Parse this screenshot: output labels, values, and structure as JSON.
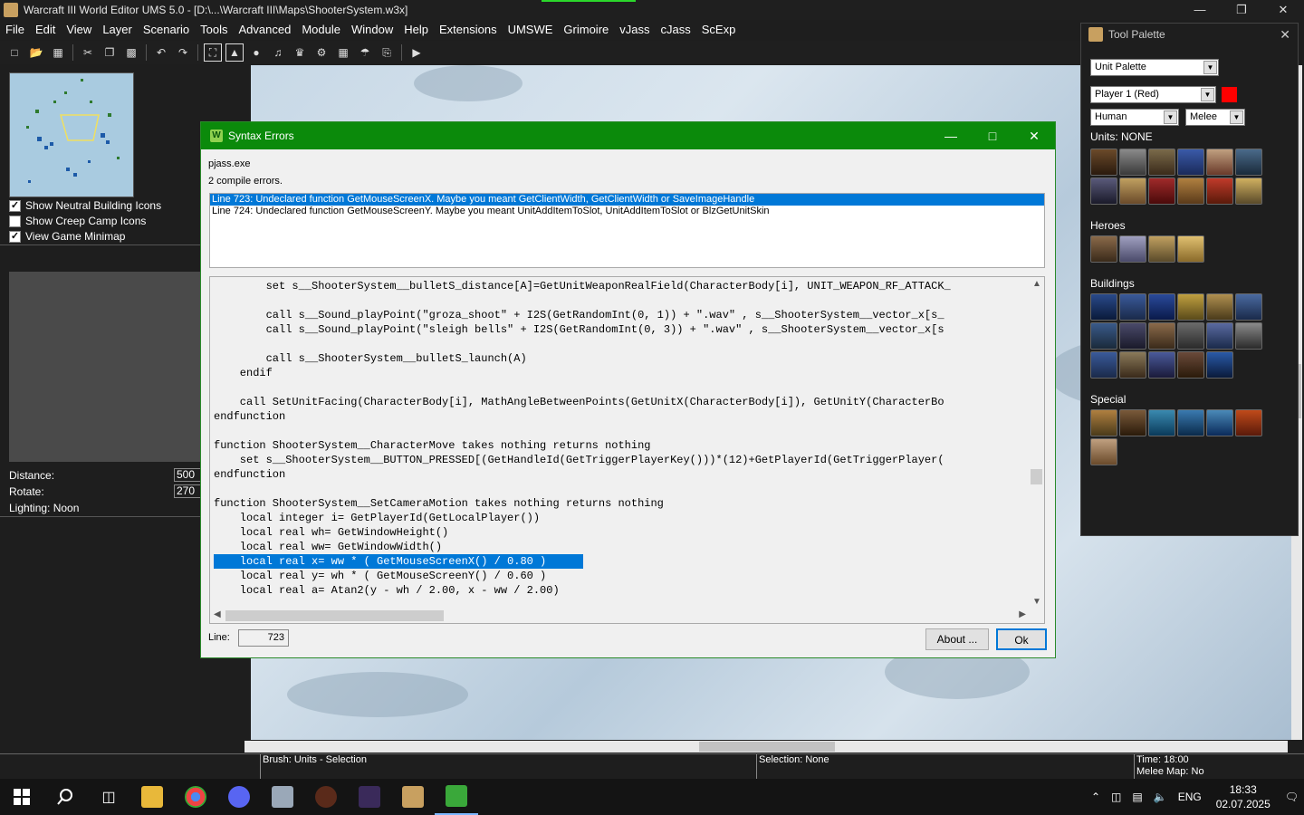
{
  "window": {
    "title": "Warcraft III World Editor UMS 5.0 - [D:\\...\\Warcraft III\\Maps\\ShooterSystem.w3x]"
  },
  "menu": [
    "File",
    "Edit",
    "View",
    "Layer",
    "Scenario",
    "Tools",
    "Advanced",
    "Module",
    "Window",
    "Help",
    "Extensions",
    "UMSWE",
    "Grimoire",
    "vJass",
    "cJass",
    "ScExp"
  ],
  "left_panel": {
    "checkboxes": [
      {
        "label": "Show Neutral Building Icons",
        "checked": true
      },
      {
        "label": "Show Creep Camp Icons",
        "checked": false
      },
      {
        "label": "View Game Minimap",
        "checked": true
      }
    ],
    "distance_label": "Distance:",
    "distance_value": "500",
    "rotate_label": "Rotate:",
    "rotate_value": "270",
    "lighting": "Lighting: Noon"
  },
  "status": {
    "brush": "Brush: Units - Selection",
    "selection": "Selection: None",
    "time": "Time: 18:00",
    "melee": "Melee Map: No"
  },
  "palette": {
    "title": "Tool Palette",
    "palette_select": "Unit Palette",
    "player_select": "Player 1 (Red)",
    "player_color": "#ff0000",
    "race_select": "Human",
    "mode_select": "Melee",
    "units_label": "Units: NONE",
    "heroes_label": "Heroes",
    "buildings_label": "Buildings",
    "special_label": "Special"
  },
  "dialog": {
    "title": "Syntax Errors",
    "exe": "pjass.exe",
    "summary": "2 compile errors.",
    "errors": [
      "Line 723:  Undeclared function GetMouseScreenX. Maybe you meant GetClientWidth, GetClientWidth or SaveImageHandle",
      "Line 724:  Undeclared function GetMouseScreenY. Maybe you meant UnitAddItemToSlot, UnitAddItemToSlot or BlzGetUnitSkin"
    ],
    "code": [
      "        set s__ShooterSystem__bulletS_distance[A]=GetUnitWeaponRealField(CharacterBody[i], UNIT_WEAPON_RF_ATTACK_",
      "",
      "        call s__Sound_playPoint(\"groza_shoot\" + I2S(GetRandomInt(0, 1)) + \".wav\" , s__ShooterSystem__vector_x[s_",
      "        call s__Sound_playPoint(\"sleigh bells\" + I2S(GetRandomInt(0, 3)) + \".wav\" , s__ShooterSystem__vector_x[s",
      "",
      "        call s__ShooterSystem__bulletS_launch(A)",
      "    endif",
      "",
      "    call SetUnitFacing(CharacterBody[i], MathAngleBetweenPoints(GetUnitX(CharacterBody[i]), GetUnitY(CharacterBo",
      "endfunction",
      "",
      "function ShooterSystem__CharacterMove takes nothing returns nothing",
      "    set s__ShooterSystem__BUTTON_PRESSED[(GetHandleId(GetTriggerPlayerKey()))*(12)+GetPlayerId(GetTriggerPlayer(",
      "endfunction",
      "",
      "function ShooterSystem__SetCameraMotion takes nothing returns nothing",
      "    local integer i= GetPlayerId(GetLocalPlayer())",
      "    local real wh= GetWindowHeight()",
      "    local real ww= GetWindowWidth()",
      "    local real x= ww * ( GetMouseScreenX() / 0.80 )",
      "    local real y= wh * ( GetMouseScreenY() / 0.60 )",
      "    local real a= Atan2(y - wh / 2.00, x - ww / 2.00)"
    ],
    "highlighted_line_index": 19,
    "line_label": "Line:",
    "line_value": "723",
    "about_button": "About ...",
    "ok_button": "Ok"
  },
  "taskbar": {
    "lang": "ENG",
    "time": "18:33",
    "date": "02.07.2025"
  }
}
